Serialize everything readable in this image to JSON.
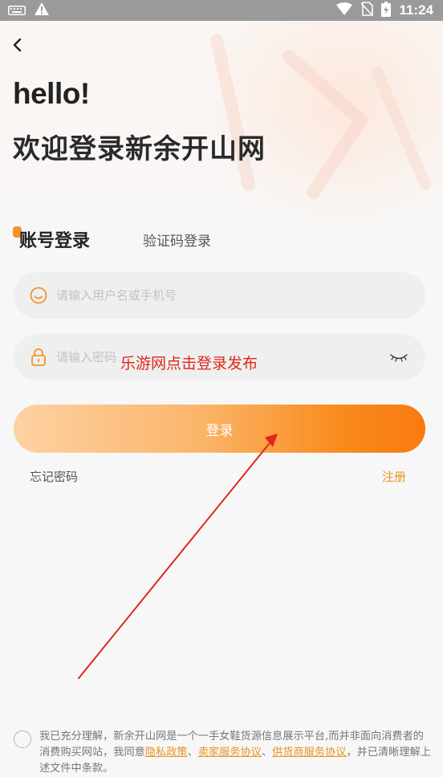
{
  "status_bar": {
    "time": "11:24",
    "left_icons": [
      "keyboard-icon",
      "warning-icon"
    ],
    "right_icons": [
      "wifi-icon",
      "no-sim-icon",
      "battery-icon"
    ]
  },
  "header": {
    "greeting": "hello!",
    "welcome": "欢迎登录新余开山网"
  },
  "tabs": {
    "account_label": "账号登录",
    "code_label": "验证码登录",
    "active": "account"
  },
  "form": {
    "username_placeholder": "请输入用户名或手机号",
    "password_placeholder": "请输入密码",
    "login_label": "登录",
    "forgot_label": "忘记密码",
    "register_label": "注册"
  },
  "overlay": {
    "caption": "乐游网点击登录发布"
  },
  "agreement": {
    "text_before": "我已充分理解，新余开山网是一个一手女鞋货源信息展示平台,而并非面向消费者的消费购买网站，我同意",
    "privacy_link": "隐私政策",
    "sep1": "、",
    "seller_link": "卖家服务协议",
    "sep2": "、",
    "supplier_link": "供货商服务协议",
    "text_after": "，并已清晰理解上述文件中条款。"
  },
  "colors": {
    "accent": "#f5922a",
    "link": "#e59422",
    "caption_red": "#e0271b",
    "button_start": "#fdd2a3",
    "button_end": "#f97a10"
  }
}
